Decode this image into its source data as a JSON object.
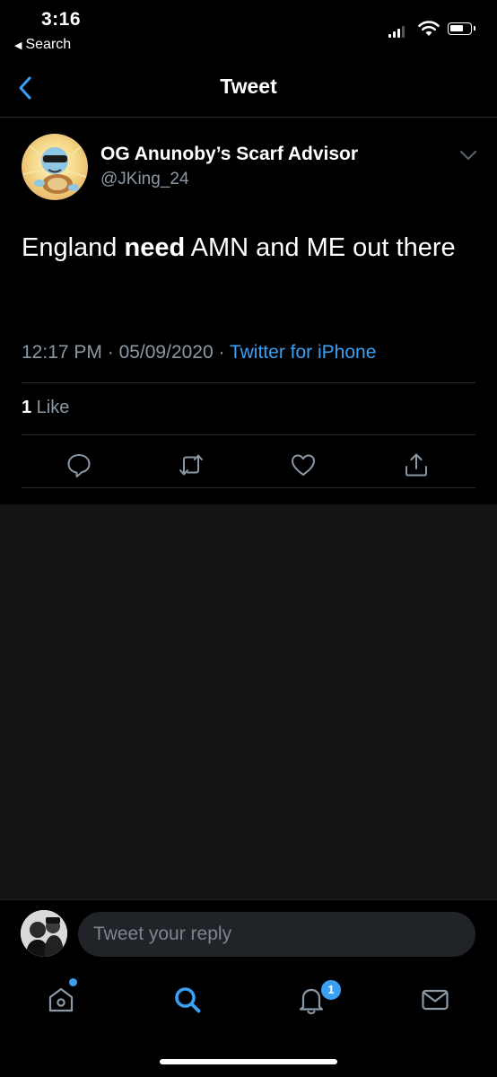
{
  "status_bar": {
    "time": "3:16",
    "back_app": "Search"
  },
  "nav": {
    "title": "Tweet"
  },
  "tweet": {
    "author_name": "OG Anunoby’s Scarf Advisor",
    "author_handle": "@JKing_24",
    "text_before": "England ",
    "text_bold": "need",
    "text_after": " AMN and ME out there",
    "time": "12:17 PM",
    "separator": " · ",
    "date": "05/09/2020",
    "source": "Twitter for iPhone",
    "likes_count": "1",
    "likes_label": " Like"
  },
  "actions": [
    "reply-icon",
    "retweet-icon",
    "like-icon",
    "share-icon"
  ],
  "reply": {
    "placeholder": "Tweet your reply"
  },
  "tab_bar": {
    "items": [
      "home-icon",
      "search-icon",
      "notifications-icon",
      "messages-icon"
    ],
    "active": "search-icon",
    "notification_badge": "1"
  },
  "colors": {
    "accent": "#3aa0f3",
    "muted": "#8b98a5",
    "background": "#000000",
    "empty_area": "#141416"
  }
}
